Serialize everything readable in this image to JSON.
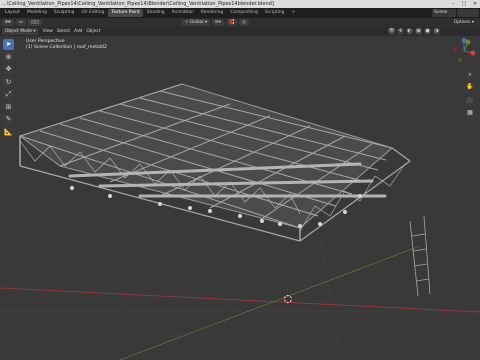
{
  "window": {
    "title": "...\\Ceiling_Ventilation_Pipes14\\Ceiling_Ventilation_Pipes14\\Blender\\Ceiling_Ventilation_Pipes14blender.blend]",
    "minimize": "–",
    "maximize": "□",
    "close": "✕"
  },
  "workspaces": {
    "tabs": [
      "Layout",
      "Modeling",
      "Sculpting",
      "UV Editing",
      "Texture Paint",
      "Shading",
      "Animation",
      "Rendering",
      "Compositing",
      "Scripting",
      "+"
    ],
    "active_index": 4,
    "scene_label": "Scene"
  },
  "header": {
    "transform_orientation": "Global",
    "options_label": "Options ▾"
  },
  "menu": {
    "mode": "Object Mode",
    "items": [
      "View",
      "Select",
      "Add",
      "Object"
    ]
  },
  "viewport": {
    "perspective_label": "User Perspective",
    "collection_label": "(1) Scene Collection | roof_metal02"
  },
  "toolbox": {
    "icons": [
      "select-cursor-icon",
      "cursor-icon",
      "move-icon",
      "rotate-icon",
      "scale-icon",
      "transform-icon",
      "annotate-icon",
      "measure-icon"
    ],
    "glyphs": [
      "➤",
      "⊕",
      "✥",
      "↻",
      "⤢",
      "⊞",
      "✎",
      "📐"
    ]
  },
  "colors": {
    "accent": "#4772b3",
    "viewport_bg": "#393939",
    "axis_x": "#a33a3a",
    "axis_y": "#6c8a2e",
    "structure": "#a8a8a8"
  }
}
